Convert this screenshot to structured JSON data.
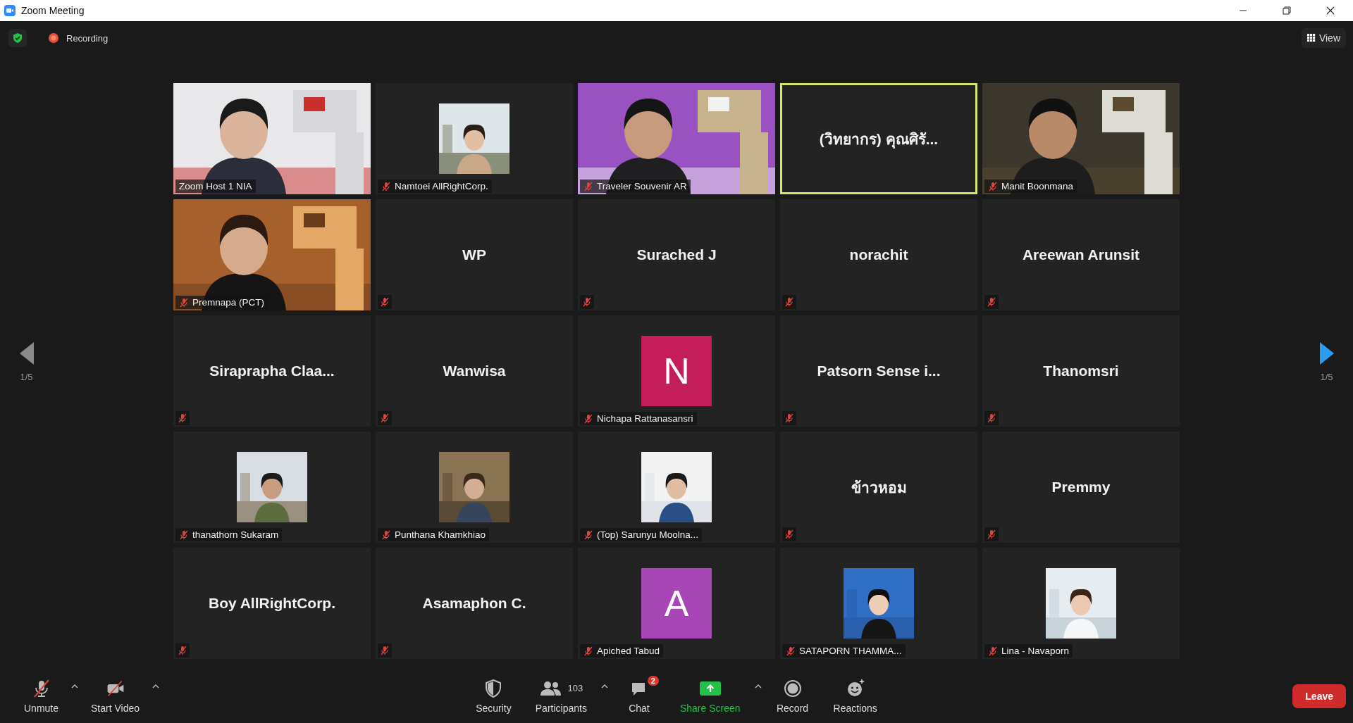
{
  "window": {
    "title": "Zoom Meeting"
  },
  "top_bar": {
    "recording": "Recording",
    "view": "View"
  },
  "pager": {
    "prev": {
      "page": "1/5",
      "disabled": true
    },
    "next": {
      "page": "1/5",
      "disabled": false
    }
  },
  "tiles": [
    {
      "kind": "video",
      "label": "Zoom Host 1 NIA",
      "muted": false,
      "speaking": false
    },
    {
      "label": "Namtoei AllRightCorp.",
      "muted": true,
      "speaking": false
    },
    {
      "kind": "video",
      "label": "Traveler Souvenir AR",
      "muted": true,
      "speaking": false
    },
    {
      "kind": "name",
      "name": "(วิทยากร) คุณศิรั...",
      "muted": false,
      "speaking": true
    },
    {
      "kind": "video",
      "label": "Manit Boonmana",
      "muted": true,
      "speaking": false
    },
    {
      "kind": "video",
      "label": "Premnapa (PCT)",
      "muted": true,
      "speaking": false
    },
    {
      "kind": "name",
      "name": "WP",
      "muted": true,
      "speaking": false
    },
    {
      "kind": "name",
      "name": "Surached J",
      "muted": true,
      "speaking": false
    },
    {
      "kind": "name",
      "name": "norachit",
      "muted": true,
      "speaking": false
    },
    {
      "kind": "name",
      "name": "Areewan Arunsit",
      "muted": true,
      "speaking": false
    },
    {
      "kind": "name",
      "name": "Siraprapha  Claa...",
      "muted": true,
      "speaking": false
    },
    {
      "kind": "name",
      "name": "Wanwisa",
      "muted": true,
      "speaking": false
    },
    {
      "kind": "avatar",
      "letter": "N",
      "color": "#c41e5a",
      "label": "Nichapa Rattanasansri",
      "muted": true,
      "speaking": false
    },
    {
      "kind": "name",
      "name": "Patsorn Sense i...",
      "muted": true,
      "speaking": false
    },
    {
      "kind": "name",
      "name": "Thanomsri",
      "muted": true,
      "speaking": false
    },
    {
      "label": "thanathorn Sukaram",
      "muted": true,
      "speaking": false
    },
    {
      "label": "Punthana Khamkhiao",
      "muted": true,
      "speaking": false
    },
    {
      "label": "(Top) Sarunyu Moolna...",
      "muted": true,
      "speaking": false
    },
    {
      "kind": "name",
      "name": "ข้าวหอม",
      "muted": true,
      "speaking": false
    },
    {
      "kind": "name",
      "name": "Premmy",
      "muted": true,
      "speaking": false
    },
    {
      "kind": "name",
      "name": "Boy AllRightCorp.",
      "muted": true,
      "speaking": false
    },
    {
      "kind": "name",
      "name": "Asamaphon C.",
      "muted": true,
      "speaking": false
    },
    {
      "kind": "avatar",
      "letter": "A",
      "color": "#a846b8",
      "label": "Apiched Tabud",
      "muted": true,
      "speaking": false
    },
    {
      "label": "SATAPORN THAMMA...",
      "muted": true,
      "speaking": false
    },
    {
      "label": "Lina - Navaporn",
      "muted": true,
      "speaking": false
    }
  ],
  "toolbar": {
    "left": [
      {
        "kind": "mic",
        "label": "Unmute",
        "caret": true
      },
      {
        "kind": "camera",
        "label": "Start Video",
        "caret": true
      }
    ],
    "center": [
      {
        "kind": "security",
        "label": "Security",
        "caret": false
      },
      {
        "kind": "participants",
        "label": "Participants",
        "count": "103",
        "caret": true
      },
      {
        "kind": "chat",
        "label": "Chat",
        "badge": "2",
        "caret": false
      },
      {
        "kind": "share",
        "label": "Share Screen",
        "caret": true
      },
      {
        "kind": "record",
        "label": "Record",
        "caret": false
      },
      {
        "kind": "reactions",
        "label": "Reactions",
        "caret": false
      }
    ],
    "leave": "Leave"
  }
}
